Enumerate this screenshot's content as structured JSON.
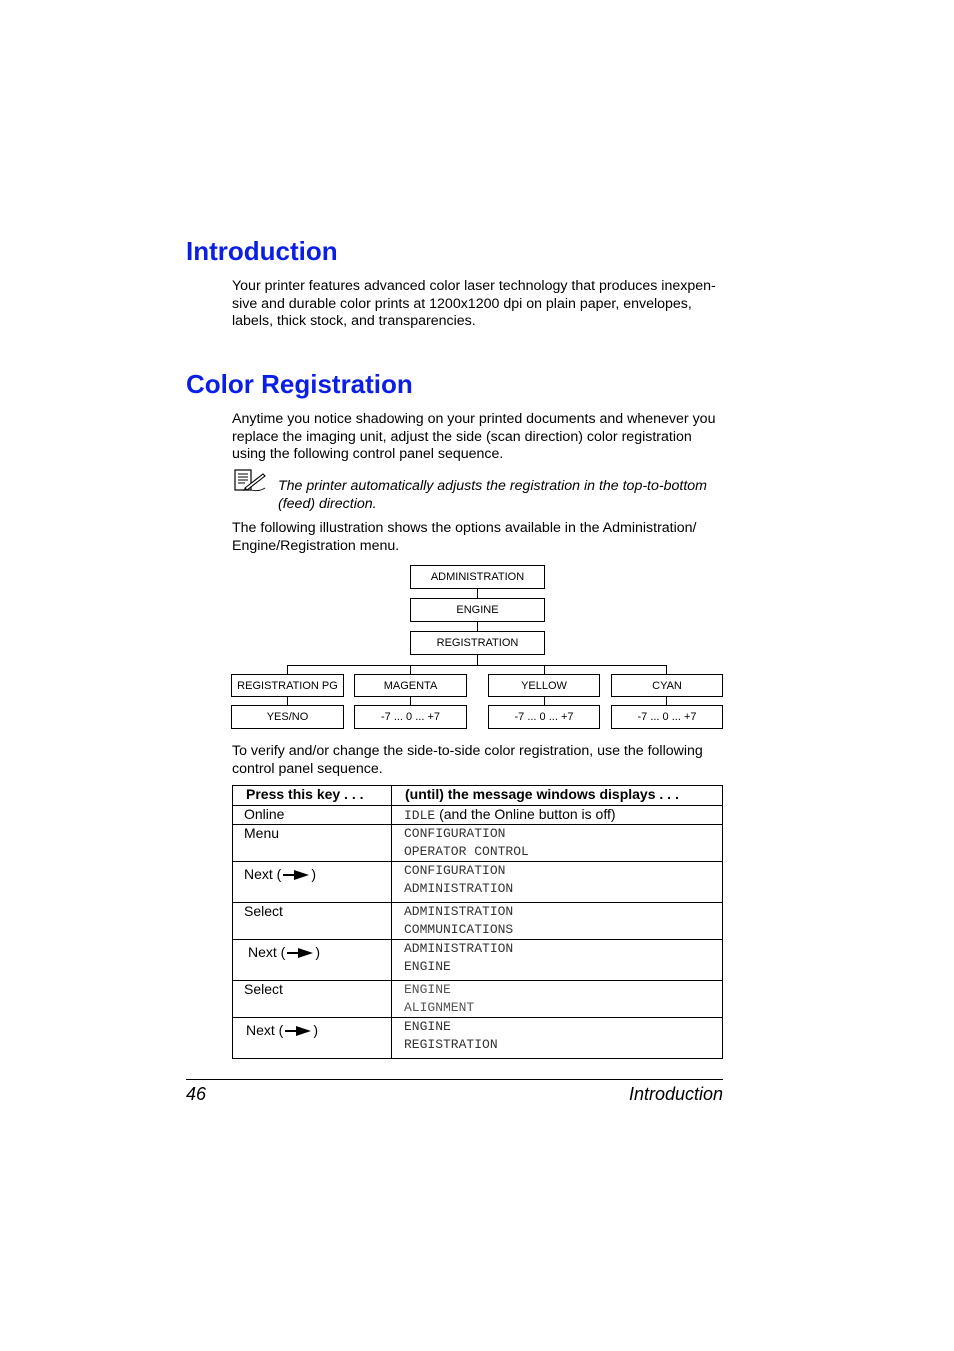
{
  "sections": [
    {
      "heading": "Introduction",
      "paragraphs": [
        "Your printer features advanced color laser technology that produces inexpen-sive and durable color prints at 1200x1200 dpi on plain paper, envelopes, labels, thick stock, and transparencies."
      ]
    },
    {
      "heading": "Color Registration",
      "paragraphs": [
        "Anytime you notice shadowing on your printed documents and whenever you replace the imaging unit, adjust the side (scan direction) color registration using the following control panel sequence.",
        "The following illustration shows the options available in the Administration/ Engine/Registration menu.",
        "To verify and/or change the side-to-side color registration, use the following control panel sequence."
      ],
      "note": {
        "icon": "note-pencil-icon",
        "text": "The printer automatically adjusts the registration in the top-to-bottom (feed) direction."
      }
    }
  ],
  "menu_diagram": {
    "levels": [
      "ADMINISTRATION",
      "ENGINE",
      "REGISTRATION"
    ],
    "options": [
      {
        "name": "REGISTRATION PG",
        "value": "YES/NO"
      },
      {
        "name": "MAGENTA",
        "value": "-7 ... 0 ... +7"
      },
      {
        "name": "YELLOW",
        "value": "-7 ... 0 ... +7"
      },
      {
        "name": "CYAN",
        "value": "-7 ... 0 ... +7"
      }
    ]
  },
  "sequence_table": {
    "headers": [
      "Press this key . . .",
      "(until) the message windows displays . . ."
    ],
    "rows": [
      {
        "key": "Online",
        "key_icon": "",
        "message_mono": "IDLE",
        "message_text": " (and the Online button is off)"
      },
      {
        "key": "Menu",
        "key_icon": "",
        "lines": [
          "CONFIGURATION",
          "OPERATOR CONTROL"
        ]
      },
      {
        "key": "Next (",
        "key_suffix": ")",
        "key_icon": "right-arrow-icon",
        "lines": [
          "CONFIGURATION",
          "ADMINISTRATION"
        ]
      },
      {
        "key": "Select",
        "key_icon": "",
        "lines": [
          "ADMINISTRATION",
          "COMMUNICATIONS"
        ]
      },
      {
        "key": "Next (",
        "key_suffix": ")",
        "key_icon": "right-arrow-icon",
        "lines": [
          "ADMINISTRATION",
          "ENGINE"
        ]
      },
      {
        "key": "Select",
        "key_icon": "",
        "lines": [
          "ENGINE",
          "ALIGNMENT"
        ]
      },
      {
        "key": "Next (",
        "key_suffix": ")",
        "key_icon": "right-arrow-icon",
        "lines": [
          "ENGINE",
          "REGISTRATION"
        ]
      }
    ]
  },
  "footer": {
    "page_number": "46",
    "chapter": "Introduction"
  },
  "colors": {
    "heading": "#0a1ee6",
    "mono_text": "#333333"
  }
}
